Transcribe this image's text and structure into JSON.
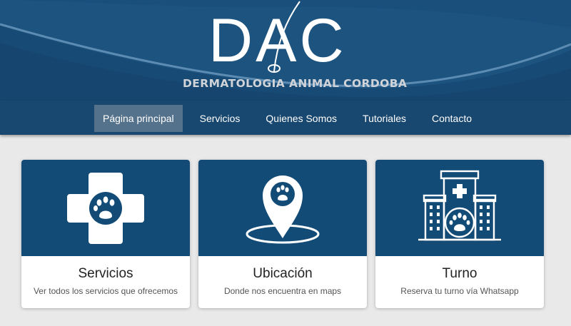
{
  "brand": {
    "logo_letters": "DAC",
    "subtitle": "DERMATOLOGIA ANIMAL CORDOBA"
  },
  "nav": {
    "items": [
      {
        "label": "Página principal",
        "active": true
      },
      {
        "label": "Servicios",
        "active": false
      },
      {
        "label": "Quienes Somos",
        "active": false
      },
      {
        "label": "Tutoriales",
        "active": false
      },
      {
        "label": "Contacto",
        "active": false
      }
    ]
  },
  "cards": [
    {
      "title": "Servicios",
      "description": "Ver todos los servicios que ofrecemos",
      "icon": "medical-cross-paw-icon"
    },
    {
      "title": "Ubicación",
      "description": "Donde nos encuentra en maps",
      "icon": "map-pin-paw-icon"
    },
    {
      "title": "Turno",
      "description": "Reserva tu turno vía Whatsapp",
      "icon": "vet-clinic-building-icon"
    }
  ],
  "colors": {
    "header_bg": "#1f5683",
    "navbar_bg": "#18476f",
    "nav_active_bg": "#55728c",
    "card_top_bg": "#134b77",
    "page_bg": "#e9e9e9"
  }
}
